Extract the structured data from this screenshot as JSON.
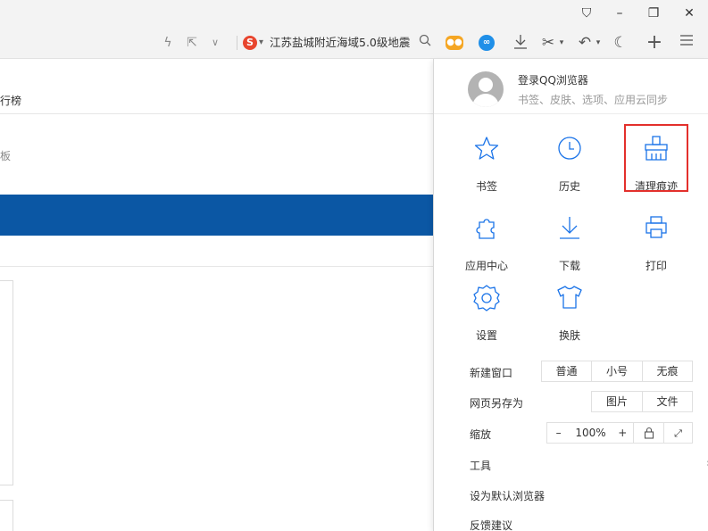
{
  "window_controls": {
    "pin": "⛉",
    "minimize": "–",
    "restore": "❐",
    "close": "✕"
  },
  "toolbar": {
    "search_text": "江苏盐城附近海域5.0级地震",
    "caret": "▾",
    "icons": [
      "lightning-icon",
      "share-icon",
      "chevron-down-icon",
      "sogou-icon",
      "search-icon",
      "game-icon",
      "ai-icon",
      "download-icon",
      "scissors-icon",
      "undo-icon",
      "night-mode-icon",
      "new-tab-icon",
      "menu-icon"
    ]
  },
  "page": {
    "rank_tab": "行榜",
    "side_text": "板"
  },
  "menu": {
    "login_title": "登录QQ浏览器",
    "login_sub": "书签、皮肤、选项、应用云同步",
    "grid": [
      {
        "label": "书签",
        "icon": "star-icon"
      },
      {
        "label": "历史",
        "icon": "clock-icon"
      },
      {
        "label": "清理痕迹",
        "icon": "broom-icon"
      },
      {
        "label": "应用中心",
        "icon": "puzzle-icon"
      },
      {
        "label": "下载",
        "icon": "download-icon"
      },
      {
        "label": "打印",
        "icon": "printer-icon"
      },
      {
        "label": "设置",
        "icon": "gear-icon"
      },
      {
        "label": "换肤",
        "icon": "shirt-icon"
      }
    ],
    "new_window": {
      "label": "新建窗口",
      "options": [
        "普通",
        "小号",
        "无痕"
      ]
    },
    "save_as": {
      "label": "网页另存为",
      "options": [
        "图片",
        "文件"
      ]
    },
    "zoom": {
      "label": "缩放",
      "minus": "–",
      "value": "100%",
      "plus": "+",
      "lock": "🔒",
      "fullscreen": "⤢"
    },
    "tools": {
      "label": "工具",
      "chevron": "›"
    },
    "set_default": "设为默认浏览器",
    "feedback": "反馈建议"
  },
  "colors": {
    "accent_blue": "#0b57a4",
    "highlight_red": "#e3302c",
    "icon_blue": "#1a73e8"
  }
}
